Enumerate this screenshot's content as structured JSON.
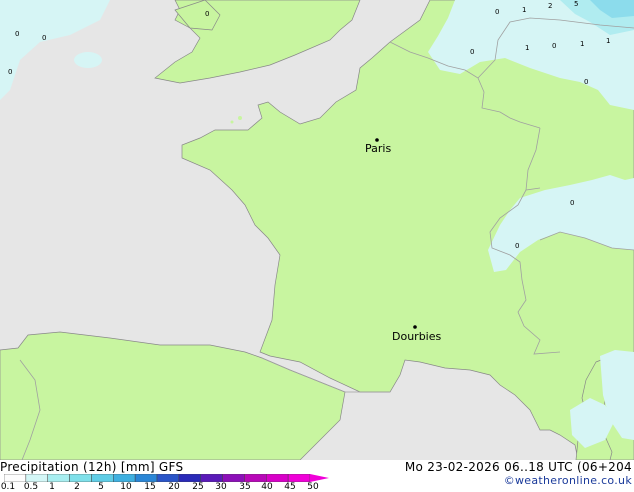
{
  "footer": {
    "title": "Precipitation (12h) [mm] GFS",
    "datetime": "Mo 23-02-2026 06..18 UTC (06+204",
    "credit": "©weatheronline.co.uk"
  },
  "legend": {
    "ticks": [
      "0.1",
      "0.5",
      "1",
      "2",
      "5",
      "10",
      "15",
      "20",
      "25",
      "30",
      "35",
      "40",
      "45",
      "50"
    ],
    "colors": [
      "#fdfdfd",
      "#d4f7f7",
      "#a8eef0",
      "#7fe0ea",
      "#5fcde6",
      "#3fb0e0",
      "#2a86d6",
      "#2a55c8",
      "#2a2ab8",
      "#5a1ab8",
      "#8c10b8",
      "#b808b8",
      "#d800c8",
      "#f000d8"
    ]
  },
  "map": {
    "colors": {
      "sea": "#e6e6e6",
      "land": "#c8f5a0",
      "precip_light": "#d6f5f5",
      "precip_medium": "#b0ecf0",
      "precip_heavy": "#8cdcec",
      "coast": "#888888",
      "border": "#a0a0a0"
    },
    "cities": [
      {
        "name": "Paris"
      },
      {
        "name": "Dourbies"
      }
    ],
    "values": [
      "0",
      "0",
      "0",
      "0",
      "1",
      "2",
      "5",
      "0",
      "0",
      "1",
      "0",
      "1",
      "1",
      "0",
      "0",
      "0"
    ]
  }
}
